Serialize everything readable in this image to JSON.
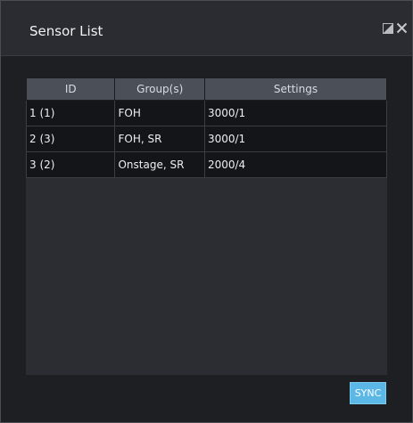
{
  "window": {
    "title": "Sensor List",
    "popout_icon": "popout-icon",
    "close_icon": "close-icon"
  },
  "table": {
    "columns": [
      "ID",
      "Group(s)",
      "Settings"
    ],
    "rows": [
      {
        "id": "1 (1)",
        "groups": "FOH",
        "settings": "3000/1"
      },
      {
        "id": "2 (3)",
        "groups": "FOH, SR",
        "settings": "3000/1"
      },
      {
        "id": "3 (2)",
        "groups": "Onstage, SR",
        "settings": "2000/4"
      }
    ]
  },
  "footer": {
    "sync_label": "SYNC"
  },
  "colors": {
    "accent": "#5bb8e6",
    "header_bg": "#4b5058",
    "row_bg": "#141518",
    "panel_bg": "#2b2d32"
  }
}
